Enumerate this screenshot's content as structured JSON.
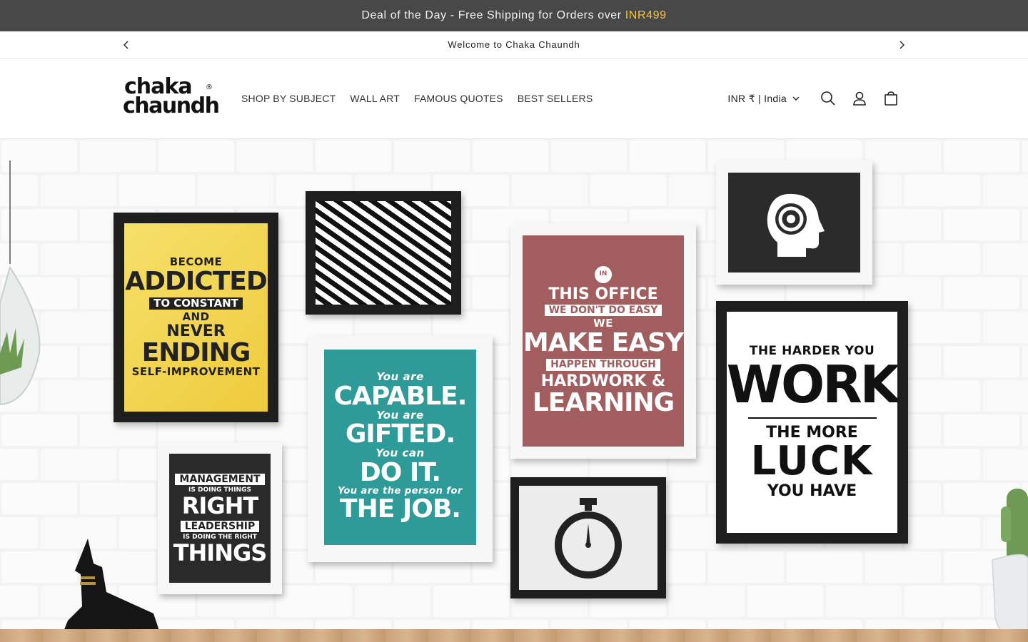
{
  "promo": {
    "text": "Deal of the Day - Free Shipping for Orders over",
    "highlight": "INR499"
  },
  "announcement": {
    "text": "Welcome to Chaka Chaundh"
  },
  "logo": {
    "line1": "chaka",
    "line2": "chaundh",
    "mark": "®"
  },
  "nav": {
    "items": [
      {
        "label": "SHOP BY SUBJECT"
      },
      {
        "label": "WALL ART"
      },
      {
        "label": "FAMOUS QUOTES"
      },
      {
        "label": "BEST SELLERS"
      }
    ]
  },
  "header": {
    "currency": "INR ₹ | India"
  },
  "icons": {
    "search": "search-icon",
    "account": "account-icon",
    "cart": "cart-icon",
    "prev": "chevron-left-icon",
    "next": "chevron-right-icon"
  },
  "posters": {
    "addicted": {
      "l1": "BECOME",
      "l2": "ADDICTED",
      "l3": "TO CONSTANT",
      "l4": "AND",
      "l5": "NEVER",
      "l6": "ENDING",
      "l7": "SELF-IMPROVEMENT"
    },
    "capable": {
      "l1": "You are",
      "l2": "CAPABLE.",
      "l3": "You are",
      "l4": "GIFTED.",
      "l5": "You can",
      "l6": "DO IT.",
      "l7": "You are the person for",
      "l8": "THE JOB."
    },
    "office": {
      "l1": "IN",
      "l2": "THIS OFFICE",
      "l3": "WE DON'T DO EASY",
      "l4": "WE",
      "l5": "MAKE EASY",
      "l6": "HAPPEN THROUGH",
      "l7": "HARDWORK &",
      "l8": "LEARNING"
    },
    "management": {
      "l1": "MANAGEMENT",
      "l2": "IS DOING THINGS",
      "l3": "RIGHT",
      "l4": "LEADERSHIP",
      "l5": "IS DOING THE RIGHT",
      "l6": "THINGS"
    },
    "harder": {
      "l1": "THE HARDER YOU",
      "l2": "WORK",
      "l3": "THE MORE",
      "l4": "LUCK",
      "l5": "YOU HAVE"
    }
  },
  "colors": {
    "promo_bg": "#484848",
    "highlight": "#f4c542",
    "teal": "#2f9b98",
    "rose": "#a25e5e",
    "yellow": "#f2d64a"
  }
}
